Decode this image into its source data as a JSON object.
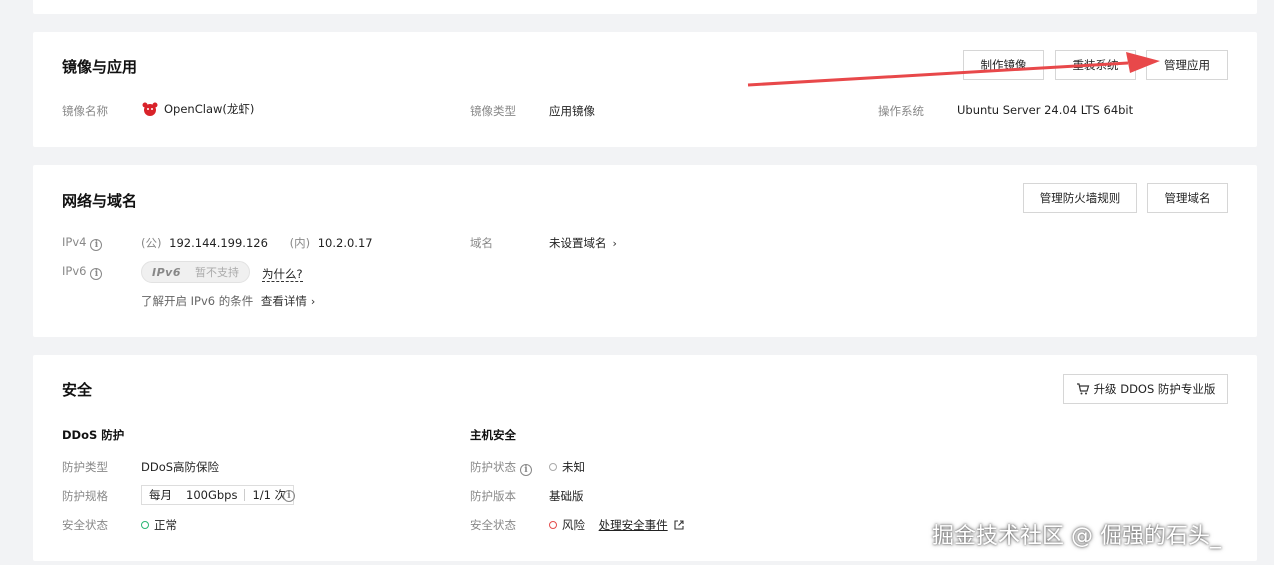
{
  "image_section": {
    "title": "镜像与应用",
    "buttons": {
      "make_image": "制作镜像",
      "reinstall": "重装系统",
      "manage_app": "管理应用"
    },
    "fields": {
      "image_name_label": "镜像名称",
      "image_name_value": "OpenClaw(龙虾)",
      "image_type_label": "镜像类型",
      "image_type_value": "应用镜像",
      "os_label": "操作系统",
      "os_value": "Ubuntu Server 24.04 LTS 64bit"
    }
  },
  "network_section": {
    "title": "网络与域名",
    "buttons": {
      "firewall": "管理防火墙规则",
      "domain": "管理域名"
    },
    "ipv4_label": "IPv4",
    "public_tag": "(公)",
    "public_ip": "192.144.199.126",
    "private_tag": "(内)",
    "private_ip": "10.2.0.17",
    "ipv6_label": "IPv6",
    "ipv6_badge": "IPv6",
    "ipv6_status": "暂不支持",
    "why_link": "为什么?",
    "ipv6_hint": "了解开启 IPv6 的条件",
    "details_link": "查看详情",
    "domain_label": "域名",
    "domain_value": "未设置域名"
  },
  "security_section": {
    "title": "安全",
    "upgrade_button": "升级 DDOS 防护专业版",
    "ddos": {
      "title": "DDoS 防护",
      "type_label": "防护类型",
      "type_value": "DDoS高防保险",
      "spec_label": "防护规格",
      "spec_period": "每月",
      "spec_bandwidth": "100Gbps",
      "spec_count": "1/1 次",
      "status_label": "安全状态",
      "status_value": "正常"
    },
    "host": {
      "title": "主机安全",
      "status_label": "防护状态",
      "status_value": "未知",
      "version_label": "防护版本",
      "version_value": "基础版",
      "security_label": "安全状态",
      "security_value": "风险",
      "events_link": "处理安全事件"
    }
  },
  "watermark": "掘金技术社区 @ 倔强的石头_",
  "colors": {
    "arrow": "#e8484a",
    "ok_dot": "#2bb673",
    "risk_dot": "#e34d4d",
    "unknown_dot": "#aaaaaa"
  }
}
